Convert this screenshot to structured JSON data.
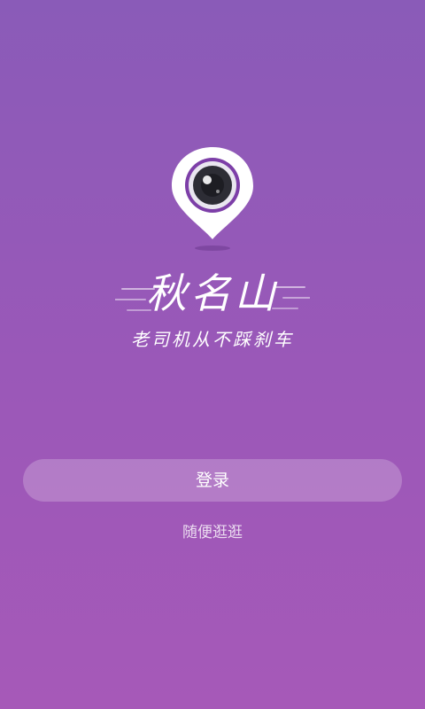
{
  "app": {
    "brand_name": "秋名山",
    "slogan": "老司机从不踩刹车"
  },
  "actions": {
    "login_label": "登录",
    "browse_label": "随便逛逛"
  },
  "icons": {
    "logo": "camera-location-pin-icon"
  },
  "colors": {
    "background_top": "#8a5bb8",
    "background_bottom": "#a659b8",
    "lens_ring": "#7d3fa8",
    "button_fill": "rgba(255,255,255,0.22)",
    "text": "#ffffff"
  }
}
